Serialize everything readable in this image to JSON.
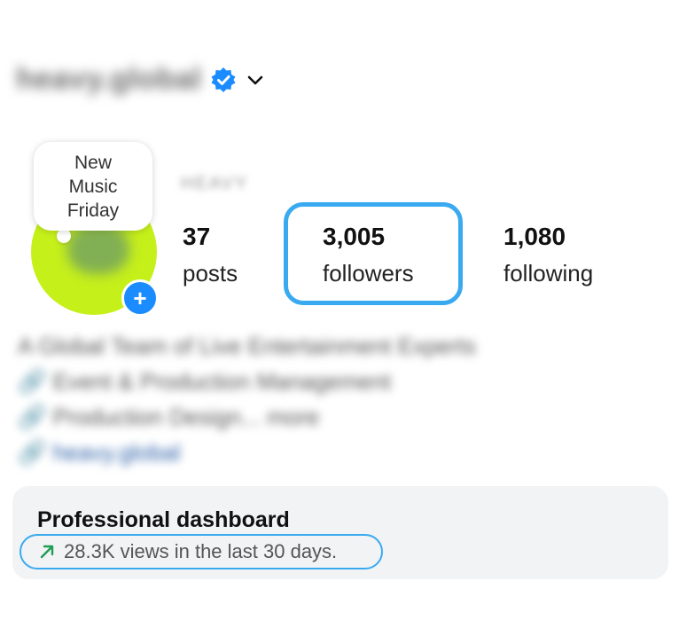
{
  "profile": {
    "username": "heavy.global",
    "display_name": "HEAVY",
    "note": [
      "New",
      "Music",
      "Friday"
    ]
  },
  "stats": {
    "posts": {
      "count": "37",
      "label": "posts"
    },
    "followers": {
      "count": "3,005",
      "label": "followers"
    },
    "following": {
      "count": "1,080",
      "label": "following"
    }
  },
  "bio": {
    "line1": "A Global Team of Live Entertainment Experts",
    "line2": "🔗 Event & Production Management",
    "line3": "🔗 Production Design... more",
    "link": "🔗 heavy.global"
  },
  "dashboard": {
    "title": "Professional dashboard",
    "subtitle": "28.3K views in the last 30 days."
  },
  "colors": {
    "accent": "#1a8cff",
    "highlight": "#3aaaf0",
    "avatar_ring": "#c6f01a",
    "trend": "#1f9d55"
  },
  "icons": [
    "verified-badge-icon",
    "chevron-down-icon",
    "plus-icon",
    "trend-up-arrow-icon"
  ]
}
